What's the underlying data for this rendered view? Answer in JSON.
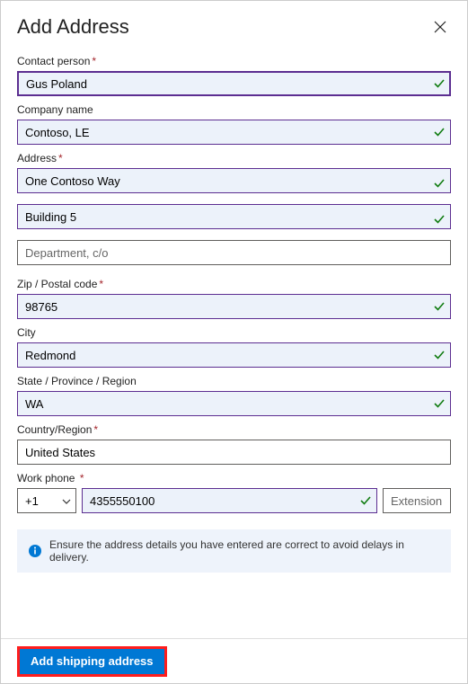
{
  "header": {
    "title": "Add Address"
  },
  "fields": {
    "contact_label": "Contact person",
    "contact_value": "Gus Poland",
    "company_label": "Company name",
    "company_value": "Contoso, LE",
    "address_label": "Address",
    "address_line1": "One Contoso Way",
    "address_line2": "Building 5",
    "address_line3_placeholder": "Department, c/o",
    "zip_label": "Zip / Postal code",
    "zip_value": "98765",
    "city_label": "City",
    "city_value": "Redmond",
    "state_label": "State / Province / Region",
    "state_value": "WA",
    "country_label": "Country/Region",
    "country_value": "United States",
    "phone_label": "Work phone",
    "phone_cc": "+1",
    "phone_value": "4355550100",
    "phone_ext_placeholder": "Extension"
  },
  "info": {
    "text": "Ensure the address details you have entered are correct to avoid delays in delivery."
  },
  "footer": {
    "primary": "Add shipping address"
  }
}
